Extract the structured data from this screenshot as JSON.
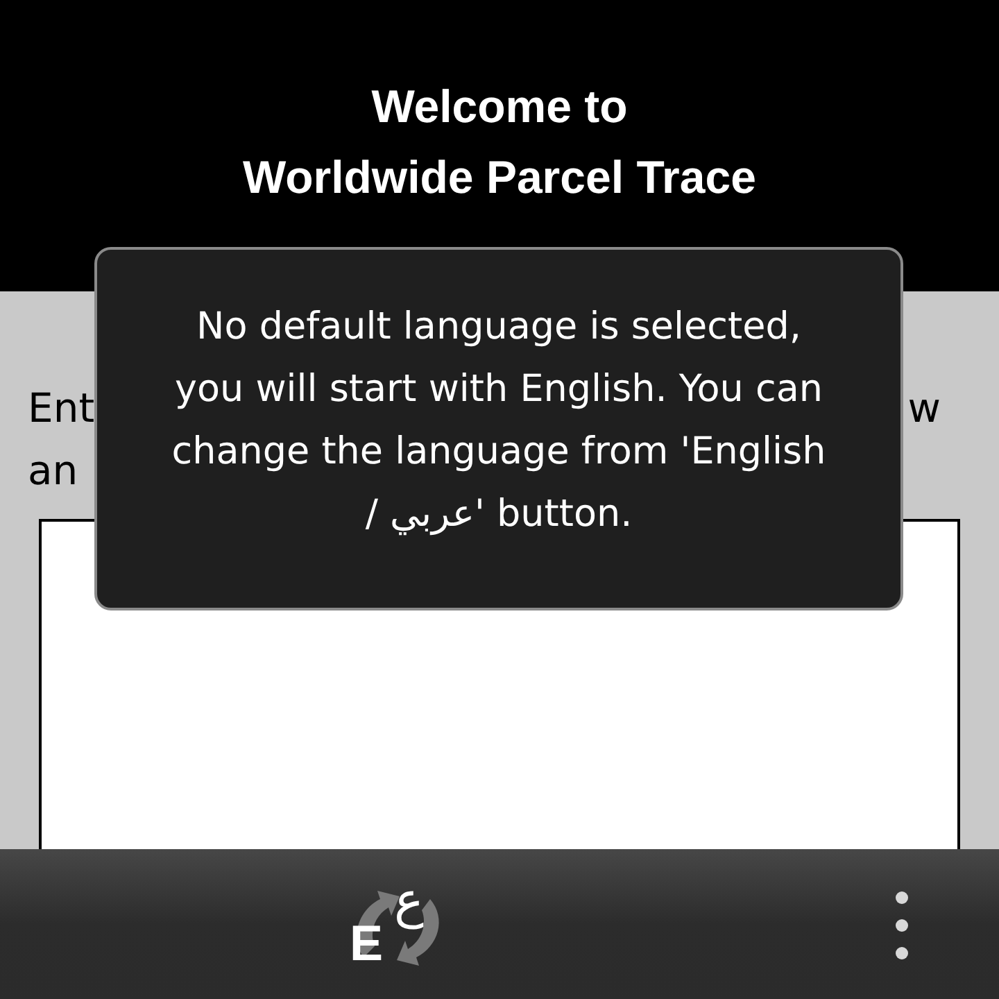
{
  "header": {
    "title_lines": [
      "Welcome to",
      "Worldwide Parcel Trace"
    ]
  },
  "instructions": {
    "line_1_start": "Ent",
    "line_1_end": "w",
    "line_2_start": "an"
  },
  "toast": {
    "lines": [
      "No default language is selected,",
      "you will start with English. You can",
      "change the language from 'English",
      "/ عربي' button."
    ]
  },
  "bottom_bar": {
    "language_button": {
      "latin_letter": "E",
      "arabic_letter": "ع"
    }
  }
}
